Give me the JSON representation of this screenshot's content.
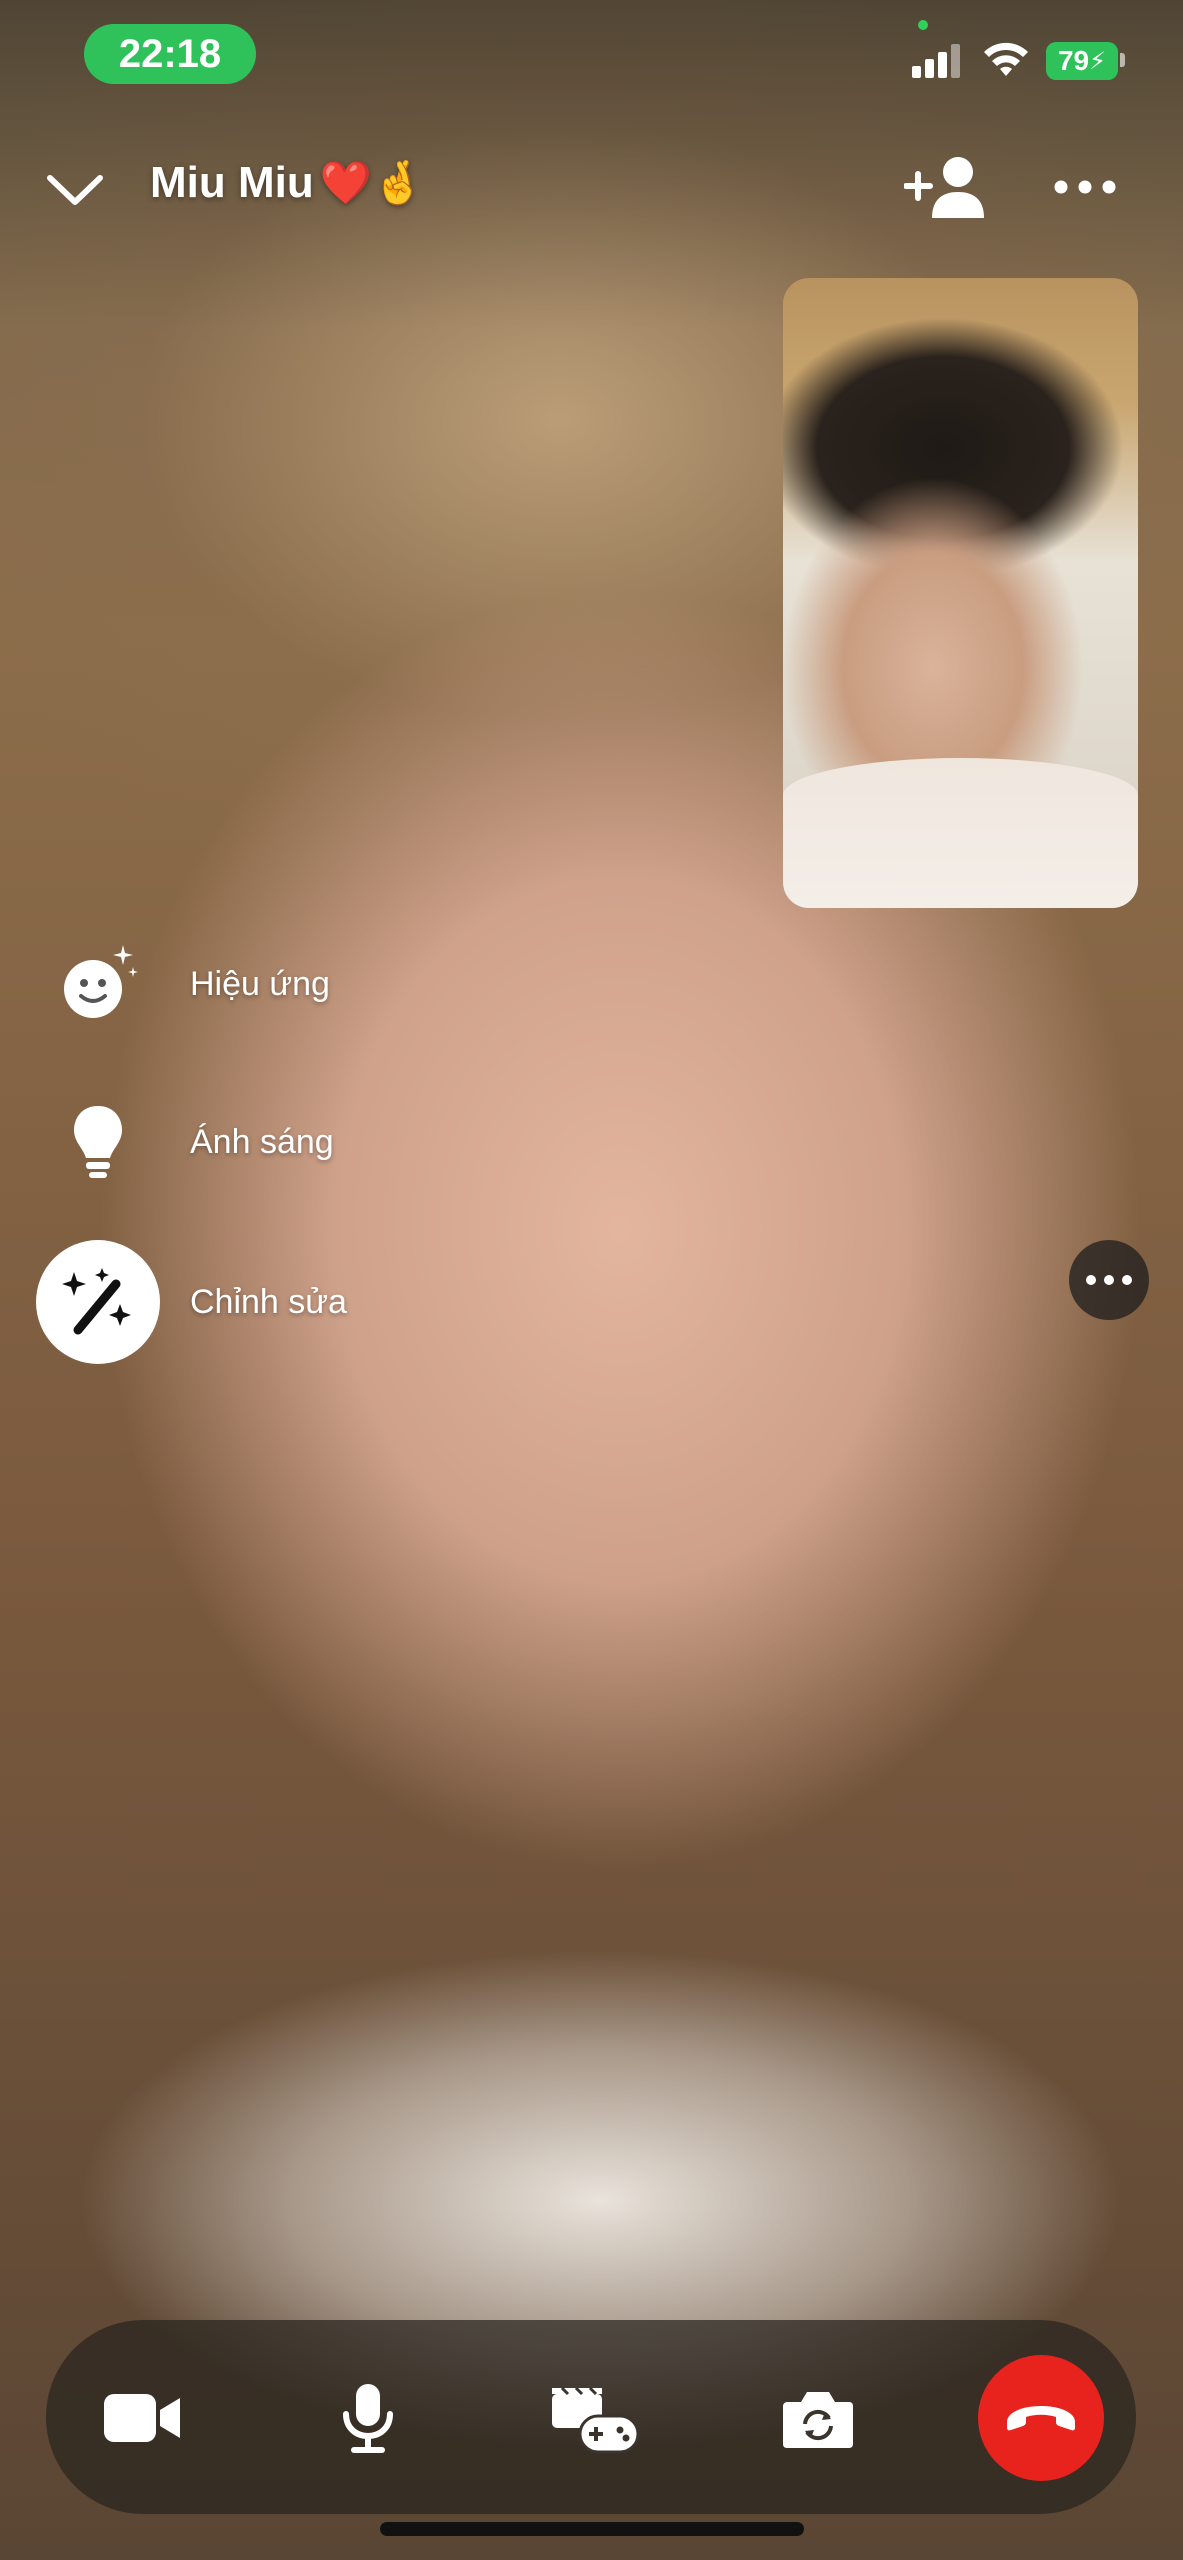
{
  "status_bar": {
    "time": "22:18",
    "battery": "79",
    "icons": [
      "signal-icon",
      "wifi-icon",
      "battery-charging-icon"
    ]
  },
  "header": {
    "caller_name": "Miu Miu",
    "caller_emoji": "❤️🤞",
    "icons": [
      "chevron-down-icon",
      "add-person-icon",
      "more-icon"
    ]
  },
  "effects_menu": {
    "items": [
      {
        "label": "Hiệu ứng",
        "icon": "sparkle-face-icon"
      },
      {
        "label": "Ánh sáng",
        "icon": "lightbulb-icon"
      },
      {
        "label": "Chỉnh sửa",
        "icon": "magic-wand-icon",
        "active": true
      }
    ]
  },
  "controls": {
    "icons": [
      "video-camera-icon",
      "microphone-icon",
      "activities-icon",
      "flip-camera-icon",
      "end-call-icon"
    ],
    "end_call_color": "#e8221c"
  },
  "colors": {
    "status_green": "#30c25a",
    "white": "#ffffff"
  }
}
